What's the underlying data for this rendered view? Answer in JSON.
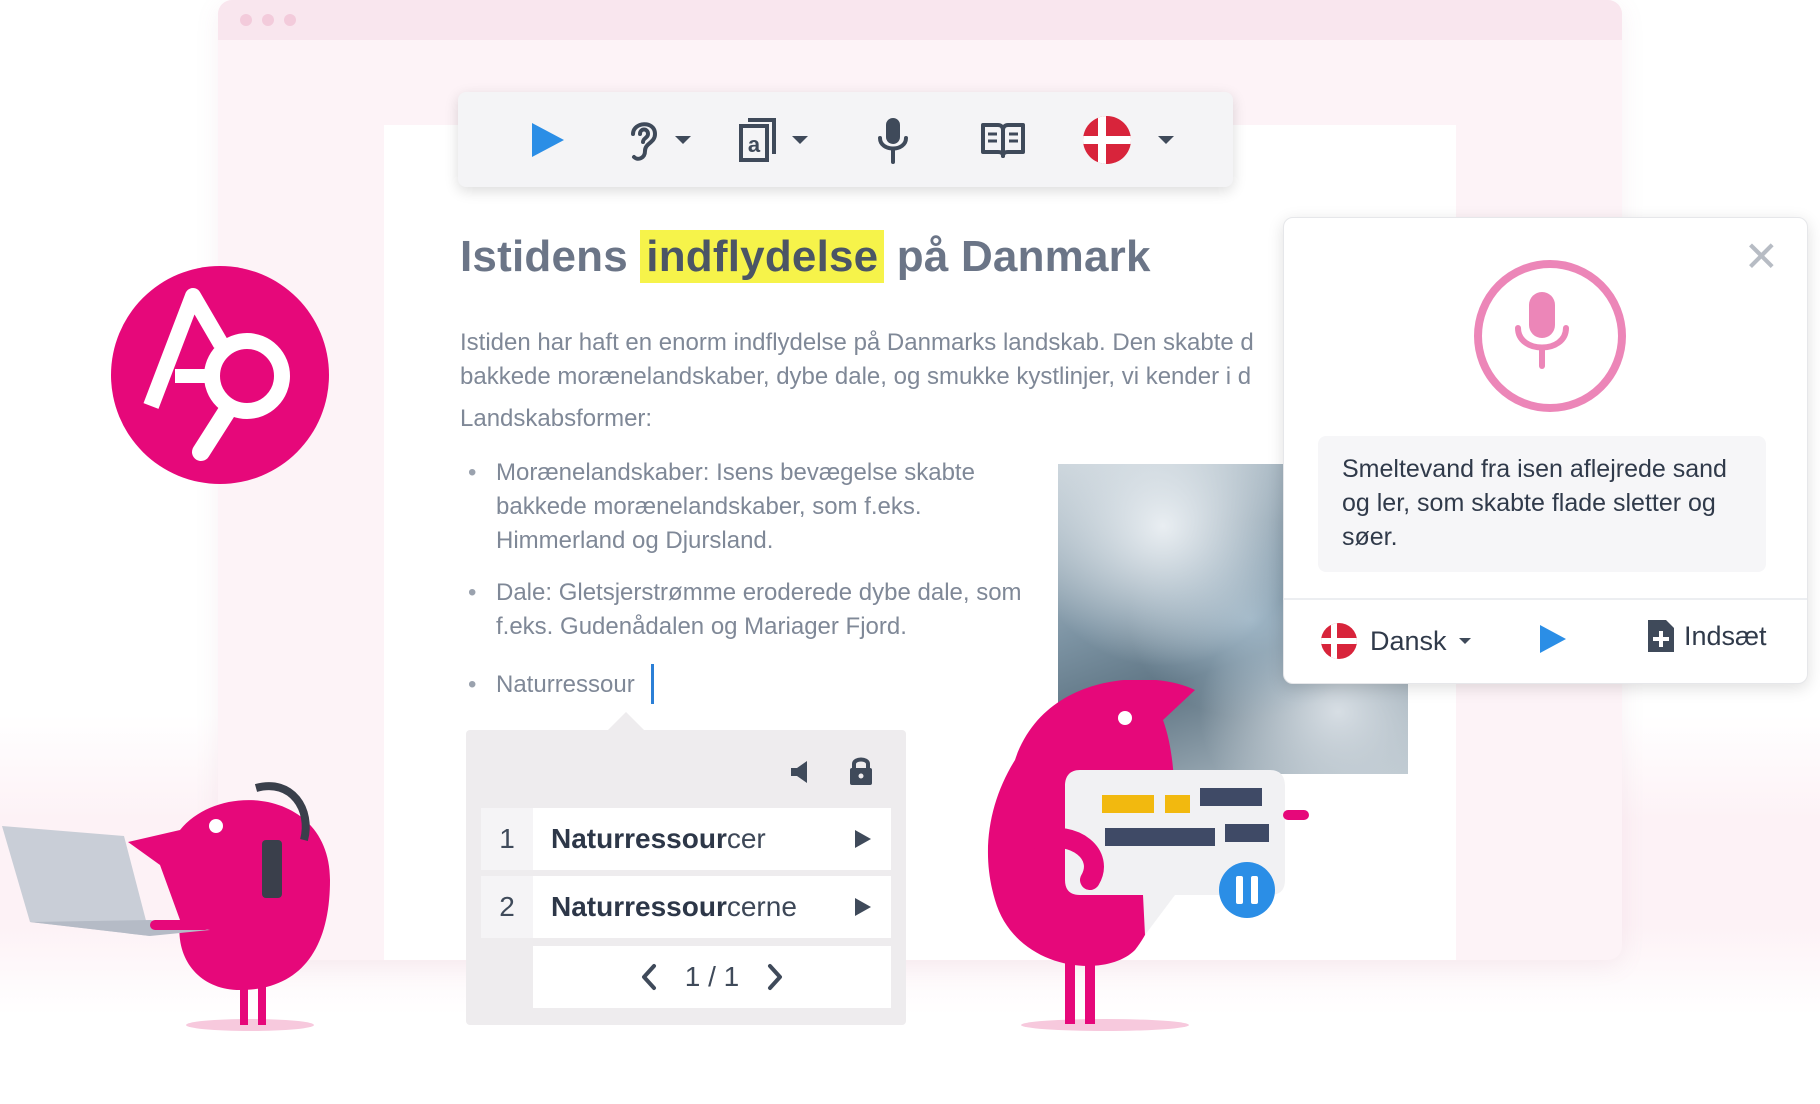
{
  "toolbar": {
    "buttons": [
      {
        "name": "play-button",
        "icon": "play-icon"
      },
      {
        "name": "listen-button",
        "icon": "ear-icon"
      },
      {
        "name": "prediction-button",
        "icon": "word-prediction-icon"
      },
      {
        "name": "dictation-button",
        "icon": "microphone-icon"
      },
      {
        "name": "dictionary-button",
        "icon": "book-icon"
      },
      {
        "name": "language-button",
        "icon": "danish-flag-icon"
      }
    ]
  },
  "document": {
    "title_before": "Istidens ",
    "title_highlight": "indflydelse",
    "title_after": " på Danmark",
    "paragraph_line1": "Istiden har haft en enorm indflydelse på Danmarks landskab. Den skabte d",
    "paragraph_line2": "bakkede morænelandskaber, dybe dale, og smukke kystlinjer, vi kender i d",
    "subheading": "Landskabsformer:",
    "bullets": [
      "Morænelandskaber: Isens bevægelse skabte bakkede morænelandskaber, som f.eks. Himmerland og Djursland.",
      "Dale: Gletsjerstrømme eroderede dybe dale, som f.eks. Gudenådalen og Mariager Fjord.",
      "Naturressour"
    ]
  },
  "suggestions": {
    "items": [
      {
        "num": "1",
        "bold": "Naturressour",
        "rest": "cer"
      },
      {
        "num": "2",
        "bold": "Naturressour",
        "rest": "cerne"
      }
    ],
    "page_indicator": "1 / 1"
  },
  "dictation_panel": {
    "transcript": "Smeltevand fra isen aflejrede sand og ler, som skabte flade sletter og søer.",
    "language": "Dansk",
    "insert_label": "Indsæt"
  },
  "colors": {
    "brand_pink": "#e6087a",
    "accent_blue": "#2b8ee6",
    "highlight_yellow": "#f6f34a",
    "mic_pink": "#ec86b8"
  }
}
